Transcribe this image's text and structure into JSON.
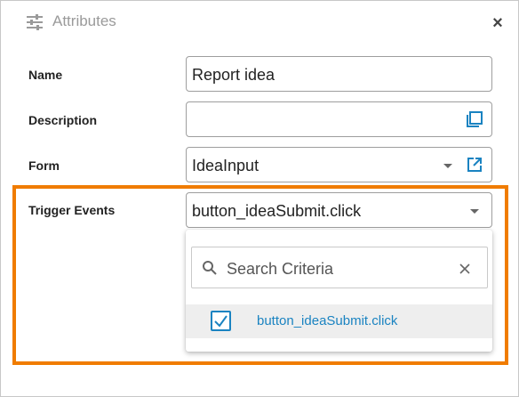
{
  "dialog": {
    "title": "Attributes",
    "close_glyph": "×",
    "title_icon": "sliders-icon"
  },
  "fields": {
    "name": {
      "label": "Name",
      "value": "Report idea"
    },
    "description": {
      "label": "Description",
      "value": "",
      "icon": "expand-editor-icon"
    },
    "form": {
      "label": "Form",
      "value": "IdeaInput",
      "icons": [
        "chevron-down-icon",
        "open-external-icon"
      ]
    },
    "trigger_events": {
      "label": "Trigger Events",
      "value": "button_ideaSubmit.click",
      "icon": "chevron-down-icon"
    }
  },
  "dropdown": {
    "search_placeholder": "Search Criteria",
    "options": [
      {
        "label": "button_ideaSubmit.click",
        "checked": true
      }
    ]
  },
  "colors": {
    "highlight": "#f07c00",
    "accent": "#1a83c1"
  }
}
